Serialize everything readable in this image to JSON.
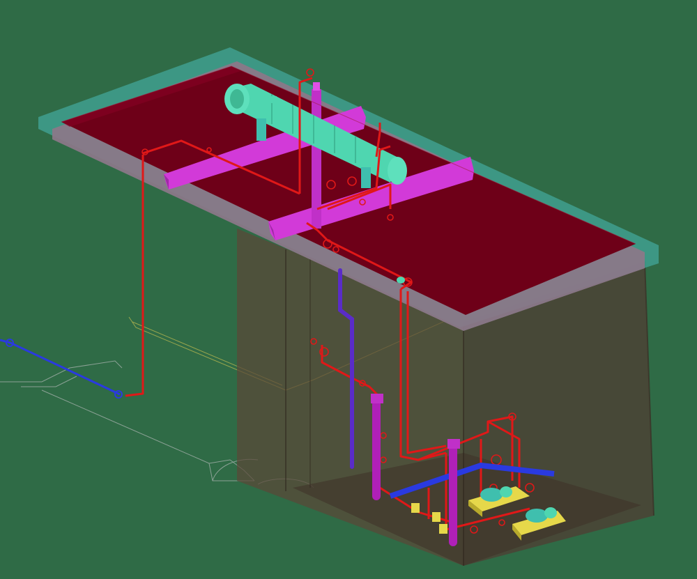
{
  "viewport": {
    "background": "#2f6b46"
  },
  "colors": {
    "slab_top": "#6e0018",
    "slab_edge_teal": "#3f9f8f",
    "slab_edge_gray": "#8a7888",
    "wall": "#5a4638",
    "beam": "#d23ad8",
    "heat_exchanger": "#4fd6b0",
    "pipe_red": "#e01818",
    "pipe_blue": "#2a3ae0",
    "pipe_violet": "#5a2cc8",
    "pump_base": "#e6d84a",
    "pump_motor": "#3fbfae",
    "outline_white": "#d8cfd8",
    "outline_yellow": "#c8c050"
  },
  "components": [
    {
      "id": "floor-slab",
      "label": ""
    },
    {
      "id": "support-beams",
      "label": ""
    },
    {
      "id": "heat-exchanger",
      "label": ""
    },
    {
      "id": "red-piping",
      "label": ""
    },
    {
      "id": "blue-pipeline",
      "label": ""
    },
    {
      "id": "pump-skid",
      "label": ""
    }
  ]
}
